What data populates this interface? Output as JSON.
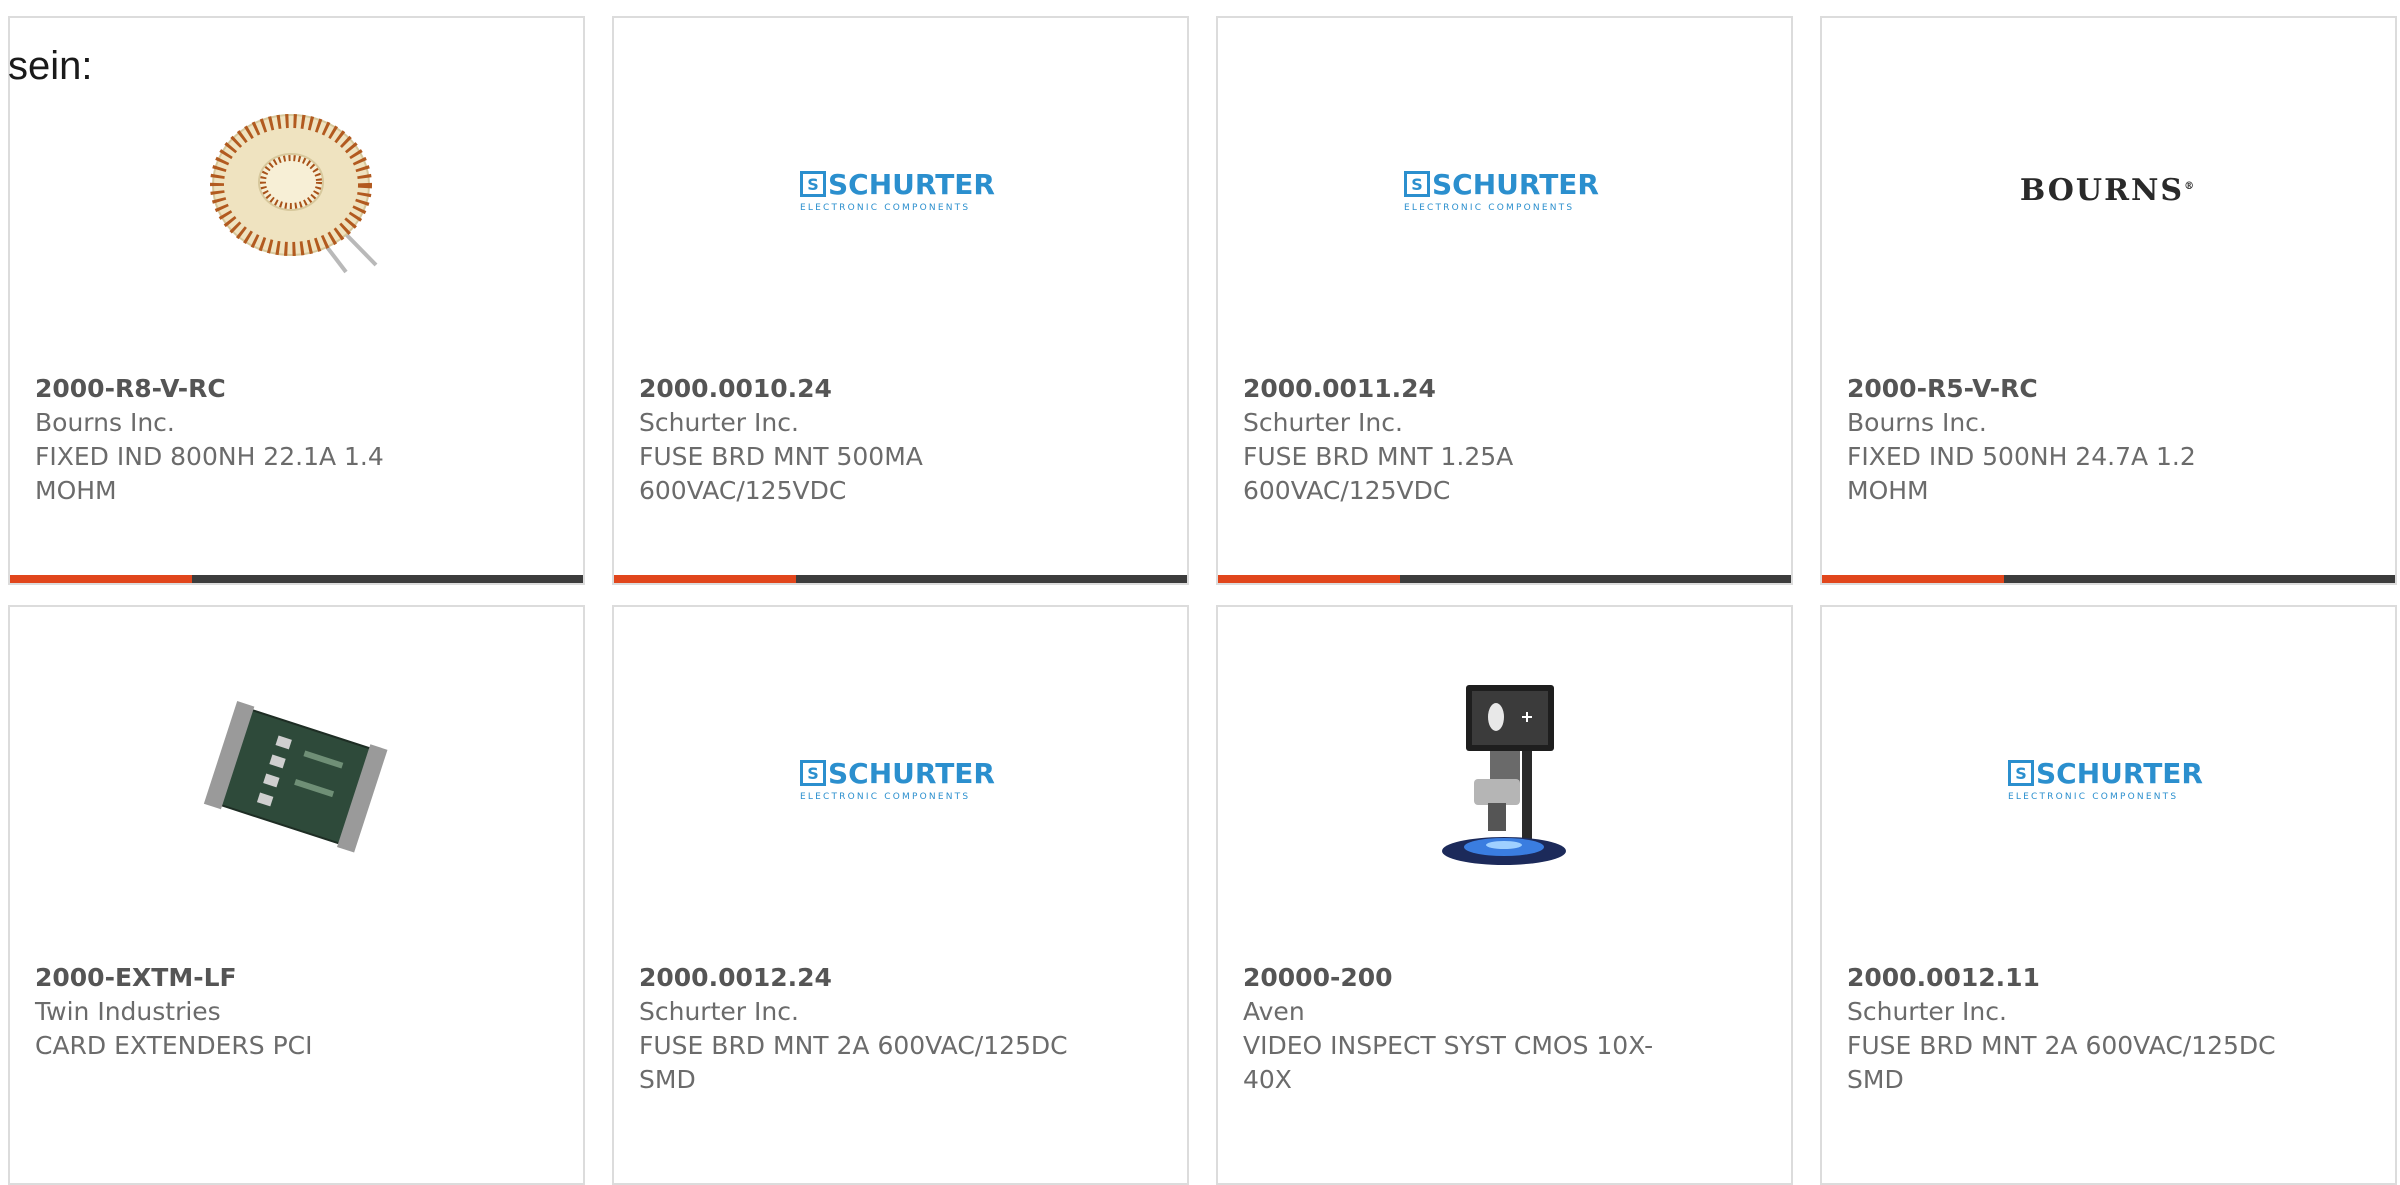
{
  "intro_text": "sein:",
  "colors": {
    "accent": "#e1461c",
    "bar": "#3c3c3c",
    "schurter_blue": "#2b8fce"
  },
  "cards": [
    {
      "part_number": "2000-R8-V-RC",
      "manufacturer": "Bourns Inc.",
      "description": "FIXED IND 800NH 22.1A 1.4 MOHM",
      "image": "toroid-inductor-image"
    },
    {
      "part_number": "2000.0010.24",
      "manufacturer": "Schurter Inc.",
      "description": "FUSE BRD MNT 500MA 600VAC/125VDC",
      "image": "schurter-logo",
      "logo": {
        "word": "SCHURTER",
        "sub": "ELECTRONIC COMPONENTS",
        "mark": "S"
      }
    },
    {
      "part_number": "2000.0011.24",
      "manufacturer": "Schurter Inc.",
      "description": "FUSE BRD MNT 1.25A 600VAC/125VDC",
      "image": "schurter-logo",
      "logo": {
        "word": "SCHURTER",
        "sub": "ELECTRONIC COMPONENTS",
        "mark": "S"
      }
    },
    {
      "part_number": "2000-R5-V-RC",
      "manufacturer": "Bourns Inc.",
      "description": "FIXED IND 500NH 24.7A 1.2 MOHM",
      "image": "bourns-logo",
      "logo": {
        "word": "BOURNS",
        "mark": "®"
      }
    },
    {
      "part_number": "2000-EXTM-LF",
      "manufacturer": "Twin Industries",
      "description": "CARD EXTENDERS PCI",
      "image": "pci-card-extender-image"
    },
    {
      "part_number": "2000.0012.24",
      "manufacturer": "Schurter Inc.",
      "description": "FUSE BRD MNT 2A 600VAC/125DC SMD",
      "image": "schurter-logo",
      "logo": {
        "word": "SCHURTER",
        "sub": "ELECTRONIC COMPONENTS",
        "mark": "S"
      }
    },
    {
      "part_number": "20000-200",
      "manufacturer": "Aven",
      "description": "VIDEO INSPECT SYST CMOS 10X-40X",
      "image": "video-inspection-system-image"
    },
    {
      "part_number": "2000.0012.11",
      "manufacturer": "Schurter Inc.",
      "description": "FUSE BRD MNT 2A 600VAC/125DC SMD",
      "image": "schurter-logo",
      "logo": {
        "word": "SCHURTER",
        "sub": "ELECTRONIC COMPONENTS",
        "mark": "S"
      }
    }
  ]
}
